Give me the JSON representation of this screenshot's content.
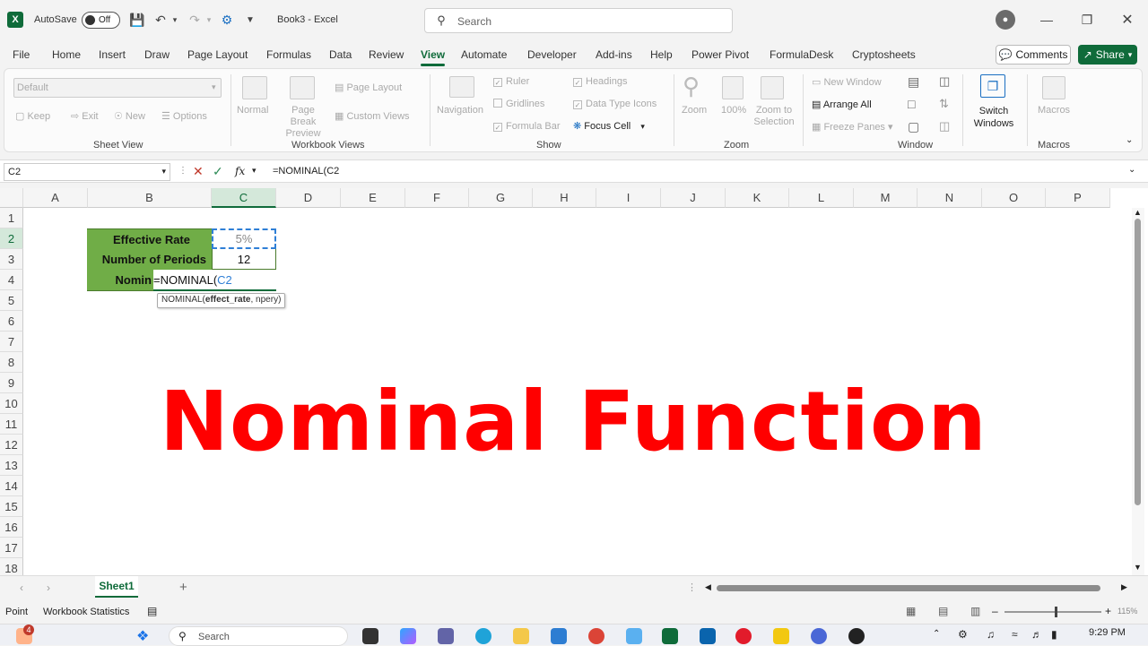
{
  "titlebar": {
    "autosave_label": "AutoSave",
    "autosave_state": "Off",
    "doc_title": "Book3 - Excel",
    "search_placeholder": "Search"
  },
  "tabs": [
    "File",
    "Home",
    "Insert",
    "Draw",
    "Page Layout",
    "Formulas",
    "Data",
    "Review",
    "View",
    "Automate",
    "Developer",
    "Add-ins",
    "Help",
    "Power Pivot",
    "FormulaDesk",
    "Cryptosheets"
  ],
  "active_tab": "View",
  "buttons": {
    "comments": "Comments",
    "share": "Share"
  },
  "ribbon": {
    "sheet_view": {
      "dropdown": "Default",
      "keep": "Keep",
      "exit": "Exit",
      "new": "New",
      "options": "Options",
      "label": "Sheet View"
    },
    "workbook_views": {
      "normal": "Normal",
      "page_break": "Page Break Preview",
      "page_layout": "Page Layout",
      "custom_views": "Custom Views",
      "label": "Workbook Views"
    },
    "show": {
      "navigation": "Navigation",
      "ruler": "Ruler",
      "gridlines": "Gridlines",
      "formula_bar": "Formula Bar",
      "headings": "Headings",
      "data_type_icons": "Data Type Icons",
      "focus_cell": "Focus Cell",
      "label": "Show"
    },
    "zoom": {
      "zoom": "Zoom",
      "pct": "100%",
      "zoom_sel": "Zoom to Selection",
      "label": "Zoom"
    },
    "window": {
      "new_window": "New Window",
      "arrange_all": "Arrange All",
      "freeze_panes": "Freeze Panes",
      "switch_windows": "Switch Windows",
      "label": "Window"
    },
    "macros": {
      "macros": "Macros",
      "label": "Macros"
    }
  },
  "formula_bar": {
    "name_box": "C2",
    "fx": "fx",
    "formula": "=NOMINAL(C2"
  },
  "columns": [
    "A",
    "B",
    "C",
    "D",
    "E",
    "F",
    "G",
    "H",
    "I",
    "J",
    "K",
    "L",
    "M",
    "N",
    "O",
    "P"
  ],
  "rows": [
    "1",
    "2",
    "3",
    "4",
    "5",
    "6",
    "7",
    "8",
    "9",
    "10",
    "11",
    "12",
    "13",
    "14",
    "15",
    "16",
    "17",
    "18"
  ],
  "cells": {
    "b2": "Effective Rate",
    "c2": "5%",
    "b3": "Number of Periods",
    "c3": "12",
    "b4": "Nomin",
    "c4_formula": "=NOMINAL(",
    "c4_ref": "C2",
    "tooltip_fn": "NOMINAL(",
    "tooltip_args": "effect_rate",
    "tooltip_rest": ", npery)"
  },
  "overlay_title": "Nominal Function",
  "sheet_tab": "Sheet1",
  "status": {
    "mode": "Point",
    "stats": "Workbook Statistics",
    "zoom": "115%"
  },
  "taskbar": {
    "search": "Search",
    "time": "9:29 PM",
    "badge": "4"
  },
  "colors": {
    "excel_green": "#0f6b3a",
    "cell_green": "#70ad47",
    "overlay_red": "#ff0000"
  }
}
